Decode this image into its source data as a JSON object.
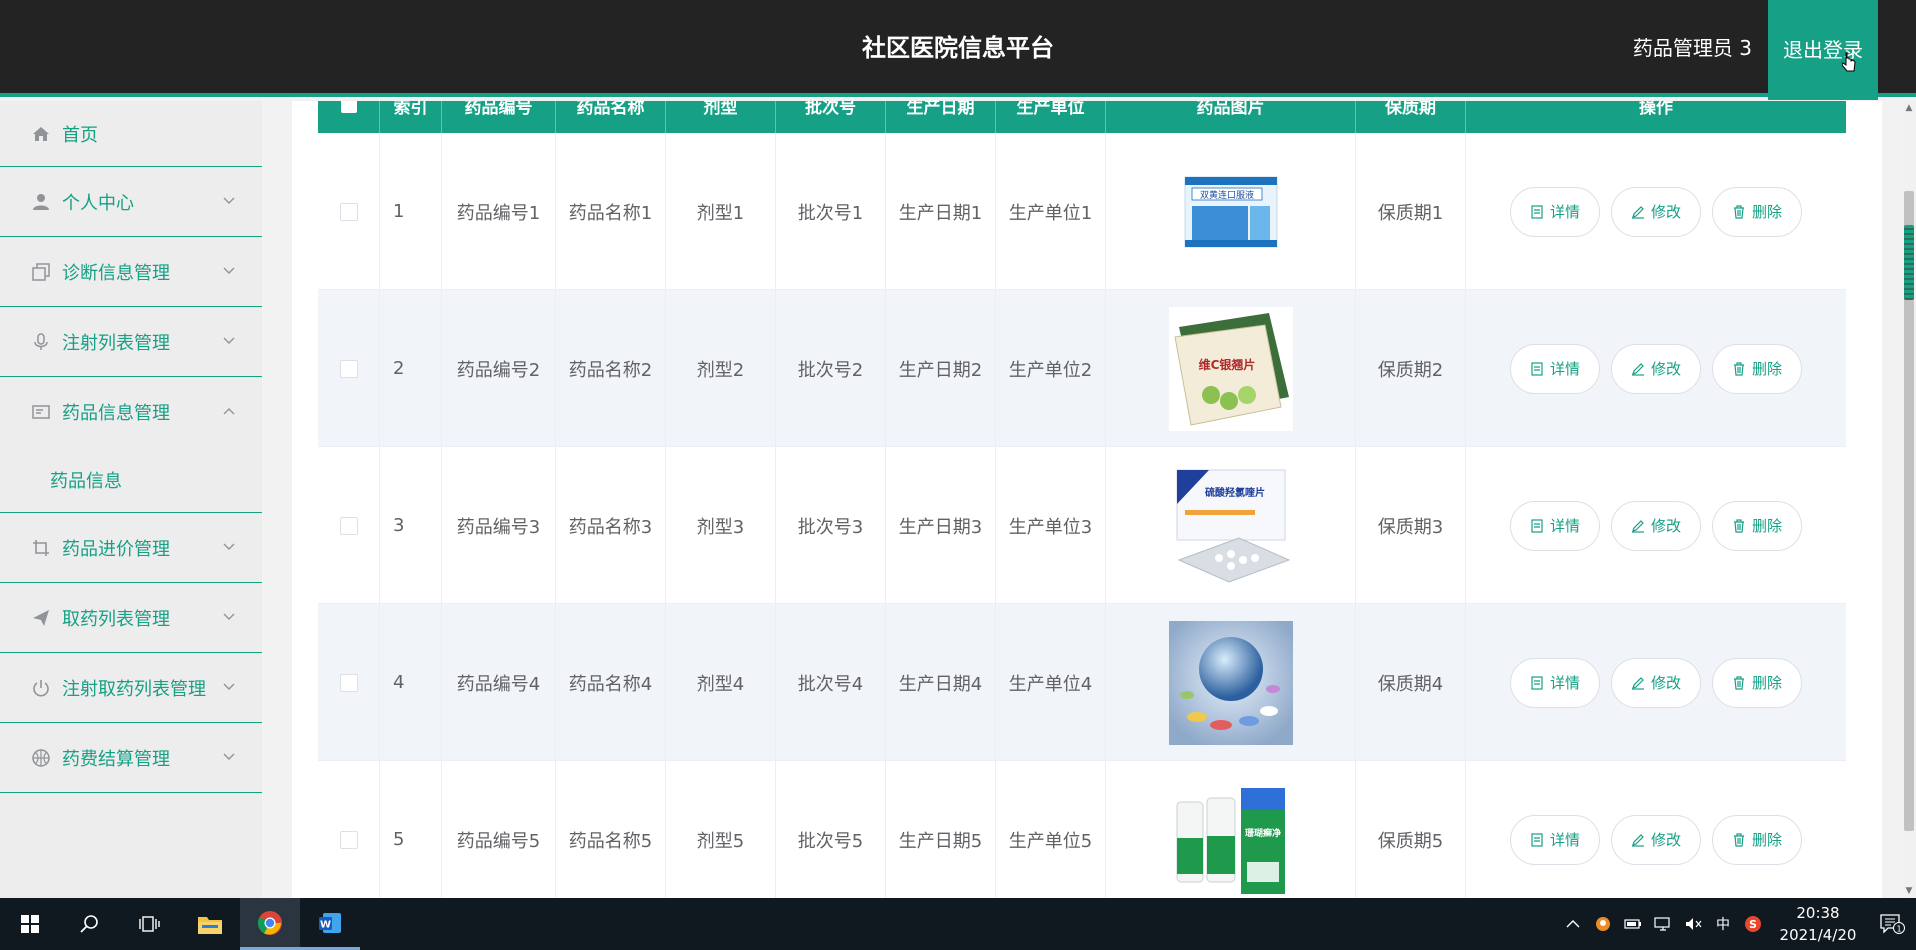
{
  "header": {
    "title": "社区医院信息平台",
    "user": "药品管理员 3",
    "logout": "退出登录"
  },
  "sidebar": {
    "items": [
      {
        "label": "首页",
        "icon": "home-icon"
      },
      {
        "label": "个人中心",
        "icon": "user-icon"
      },
      {
        "label": "诊断信息管理",
        "icon": "copy-icon"
      },
      {
        "label": "注射列表管理",
        "icon": "microphone-icon"
      },
      {
        "label": "药品信息管理",
        "icon": "tickets-icon",
        "sub": "药品信息"
      },
      {
        "label": "药品进价管理",
        "icon": "crop-icon"
      },
      {
        "label": "取药列表管理",
        "icon": "send-icon"
      },
      {
        "label": "注射取药列表管理",
        "icon": "power-icon"
      },
      {
        "label": "药费结算管理",
        "icon": "basketball-icon"
      }
    ]
  },
  "table": {
    "headers": [
      "",
      "索引",
      "药品编号",
      "药品名称",
      "剂型",
      "批次号",
      "生产日期",
      "生产单位",
      "药品图片",
      "保质期",
      "操作"
    ],
    "rows": [
      {
        "index": "1",
        "code": "药品编号1",
        "name": "药品名称1",
        "form": "剂型1",
        "batch": "批次号1",
        "date": "生产日期1",
        "maker": "生产单位1",
        "shelf": "保质期1"
      },
      {
        "index": "2",
        "code": "药品编号2",
        "name": "药品名称2",
        "form": "剂型2",
        "batch": "批次号2",
        "date": "生产日期2",
        "maker": "生产单位2",
        "shelf": "保质期2"
      },
      {
        "index": "3",
        "code": "药品编号3",
        "name": "药品名称3",
        "form": "剂型3",
        "batch": "批次号3",
        "date": "生产日期3",
        "maker": "生产单位3",
        "shelf": "保质期3"
      },
      {
        "index": "4",
        "code": "药品编号4",
        "name": "药品名称4",
        "form": "剂型4",
        "batch": "批次号4",
        "date": "生产日期4",
        "maker": "生产单位4",
        "shelf": "保质期4"
      },
      {
        "index": "5",
        "code": "药品编号5",
        "name": "药品名称5",
        "form": "剂型5",
        "batch": "批次号5",
        "date": "生产日期5",
        "maker": "生产单位5",
        "shelf": "保质期5"
      }
    ],
    "actions": {
      "detail": "详情",
      "edit": "修改",
      "delete": "删除"
    },
    "images": [
      {
        "label": "双黄连口服液"
      },
      {
        "label": "维C银翘片"
      },
      {
        "label": "硫酸羟氯喹片"
      },
      {
        "label": ""
      },
      {
        "label": "珊瑚癣净"
      }
    ]
  },
  "taskbar": {
    "ime": "中",
    "time": "20:38",
    "date": "2021/4/20",
    "notifications": "1"
  },
  "colors": {
    "accent": "#16a085",
    "header_bg": "#232323",
    "sidebar_bg": "#ededed"
  }
}
